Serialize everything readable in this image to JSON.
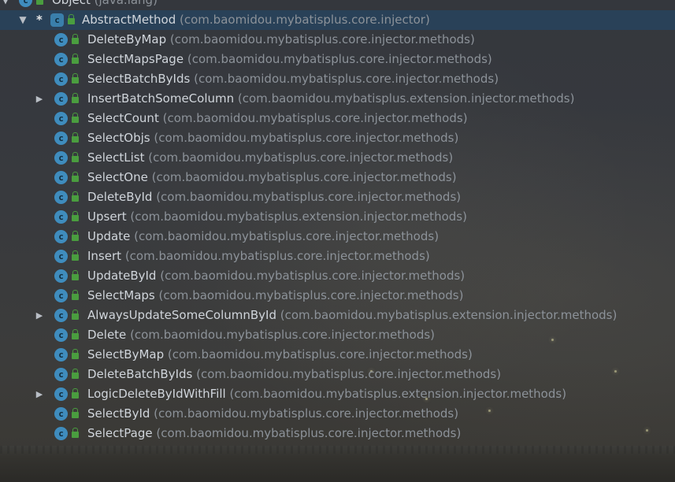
{
  "tree": {
    "root": {
      "name": "Object",
      "package": "(java.lang)"
    },
    "selected": {
      "marker": "*",
      "name": "AbstractMethod",
      "package": "(com.baomidou.mybatisplus.core.injector)"
    },
    "children": [
      {
        "name": "DeleteByMap",
        "package": "(com.baomidou.mybatisplus.core.injector.methods)"
      },
      {
        "name": "SelectMapsPage",
        "package": "(com.baomidou.mybatisplus.core.injector.methods)"
      },
      {
        "name": "SelectBatchByIds",
        "package": "(com.baomidou.mybatisplus.core.injector.methods)"
      },
      {
        "name": "InsertBatchSomeColumn",
        "package": "(com.baomidou.mybatisplus.extension.injector.methods)"
      },
      {
        "name": "SelectCount",
        "package": "(com.baomidou.mybatisplus.core.injector.methods)"
      },
      {
        "name": "SelectObjs",
        "package": "(com.baomidou.mybatisplus.core.injector.methods)"
      },
      {
        "name": "SelectList",
        "package": "(com.baomidou.mybatisplus.core.injector.methods)"
      },
      {
        "name": "SelectOne",
        "package": "(com.baomidou.mybatisplus.core.injector.methods)"
      },
      {
        "name": "DeleteById",
        "package": "(com.baomidou.mybatisplus.core.injector.methods)"
      },
      {
        "name": "Upsert",
        "package": "(com.baomidou.mybatisplus.extension.injector.methods)"
      },
      {
        "name": "Update",
        "package": "(com.baomidou.mybatisplus.core.injector.methods)"
      },
      {
        "name": "Insert",
        "package": "(com.baomidou.mybatisplus.core.injector.methods)"
      },
      {
        "name": "UpdateById",
        "package": "(com.baomidou.mybatisplus.core.injector.methods)"
      },
      {
        "name": "SelectMaps",
        "package": "(com.baomidou.mybatisplus.core.injector.methods)"
      },
      {
        "name": "AlwaysUpdateSomeColumnById",
        "package": "(com.baomidou.mybatisplus.extension.injector.methods)"
      },
      {
        "name": "Delete",
        "package": "(com.baomidou.mybatisplus.core.injector.methods)"
      },
      {
        "name": "SelectByMap",
        "package": "(com.baomidou.mybatisplus.core.injector.methods)"
      },
      {
        "name": "DeleteBatchByIds",
        "package": "(com.baomidou.mybatisplus.core.injector.methods)"
      },
      {
        "name": "LogicDeleteByIdWithFill",
        "package": "(com.baomidou.mybatisplus.extension.injector.methods)"
      },
      {
        "name": "SelectById",
        "package": "(com.baomidou.mybatisplus.core.injector.methods)"
      },
      {
        "name": "SelectPage",
        "package": "(com.baomidou.mybatisplus.core.injector.methods)"
      }
    ]
  },
  "icons": {
    "class": "class-icon",
    "abstract_class": "abstract-class-icon",
    "visibility": "public-lock-icon",
    "expand": "expand-arrow-icon",
    "collapse": "collapse-arrow-icon"
  },
  "colors": {
    "selection": "#28425a",
    "class_icon": "#3f8cbd",
    "lock_icon": "#4a9d3f",
    "name_text": "#d0d5db",
    "package_text": "#8c9299"
  }
}
